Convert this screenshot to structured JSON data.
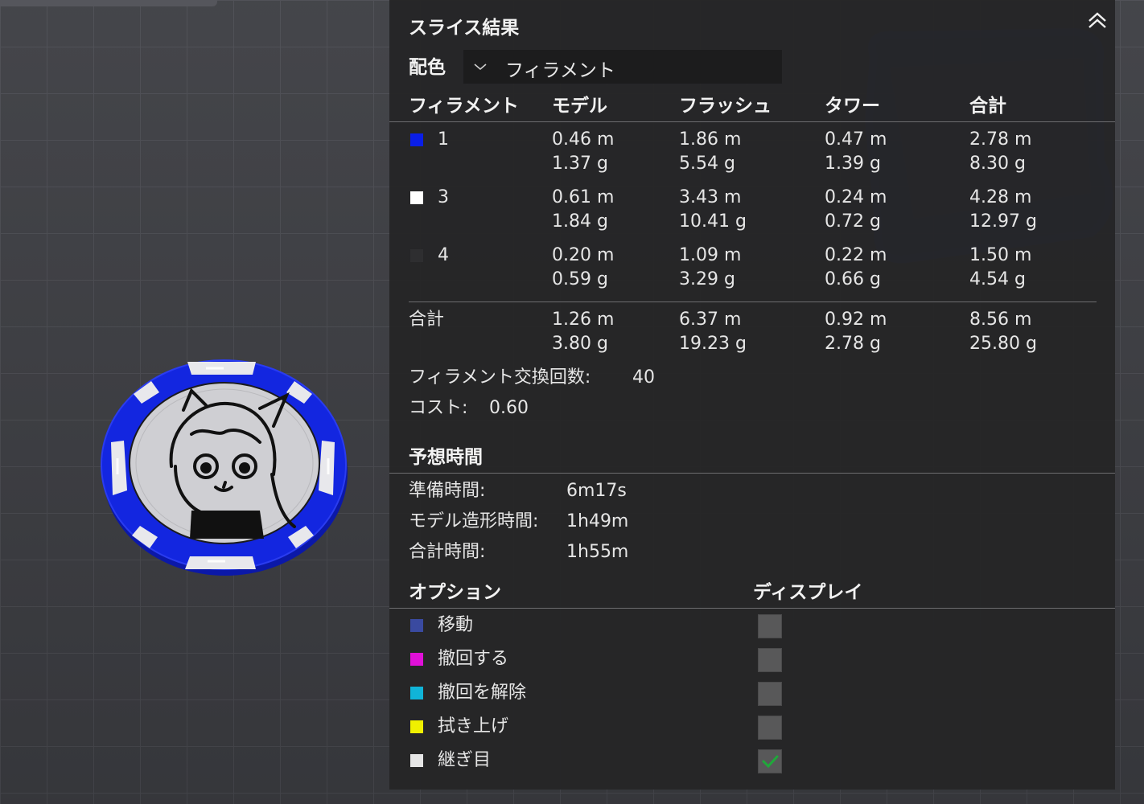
{
  "panel": {
    "title": "スライス結果",
    "color_scheme": {
      "label": "配色",
      "value": "フィラメント"
    },
    "columns": [
      "フィラメント",
      "モデル",
      "フラッシュ",
      "タワー",
      "合計"
    ],
    "filaments": [
      {
        "id": "1",
        "color": "#0a1ee8",
        "model": [
          "0.46 m",
          "1.37 g"
        ],
        "flush": [
          "1.86 m",
          "5.54 g"
        ],
        "tower": [
          "0.47 m",
          "1.39 g"
        ],
        "total": [
          "2.78 m",
          "8.30 g"
        ]
      },
      {
        "id": "3",
        "color": "#ffffff",
        "model": [
          "0.61 m",
          "1.84 g"
        ],
        "flush": [
          "3.43 m",
          "10.41 g"
        ],
        "tower": [
          "0.24 m",
          "0.72 g"
        ],
        "total": [
          "4.28 m",
          "12.97 g"
        ]
      },
      {
        "id": "4",
        "color": "#2e2e30",
        "model": [
          "0.20 m",
          "0.59 g"
        ],
        "flush": [
          "1.09 m",
          "3.29 g"
        ],
        "tower": [
          "0.22 m",
          "0.66 g"
        ],
        "total": [
          "1.50 m",
          "4.54 g"
        ]
      }
    ],
    "totals": {
      "label": "合計",
      "model": [
        "1.26 m",
        "3.80 g"
      ],
      "flush": [
        "6.37 m",
        "19.23 g"
      ],
      "tower": [
        "0.92 m",
        "2.78 g"
      ],
      "total": [
        "8.56 m",
        "25.80 g"
      ]
    },
    "filament_changes": {
      "label": "フィラメント交換回数:",
      "value": "40"
    },
    "cost": {
      "label": "コスト:",
      "value": "0.60"
    },
    "estimated_time": {
      "title": "予想時間",
      "rows": [
        {
          "label": "準備時間:",
          "value": "6m17s"
        },
        {
          "label": "モデル造形時間:",
          "value": "1h49m"
        },
        {
          "label": "合計時間:",
          "value": "1h55m"
        }
      ]
    },
    "options": {
      "header": "オプション",
      "display_header": "ディスプレイ",
      "items": [
        {
          "label": "移動",
          "color": "#3a4aa0",
          "checked": false
        },
        {
          "label": "撤回する",
          "color": "#e010d8",
          "checked": false
        },
        {
          "label": "撤回を解除",
          "color": "#10b4d8",
          "checked": false
        },
        {
          "label": "拭き上げ",
          "color": "#f0f000",
          "checked": false
        },
        {
          "label": "継ぎ目",
          "color": "#e6e6e6",
          "checked": true
        }
      ]
    },
    "icons": {
      "collapse": "chevron-double-up-icon",
      "dropdown": "chevron-down-icon",
      "check": "checkmark-icon",
      "check_color": "#1fa83a"
    }
  }
}
